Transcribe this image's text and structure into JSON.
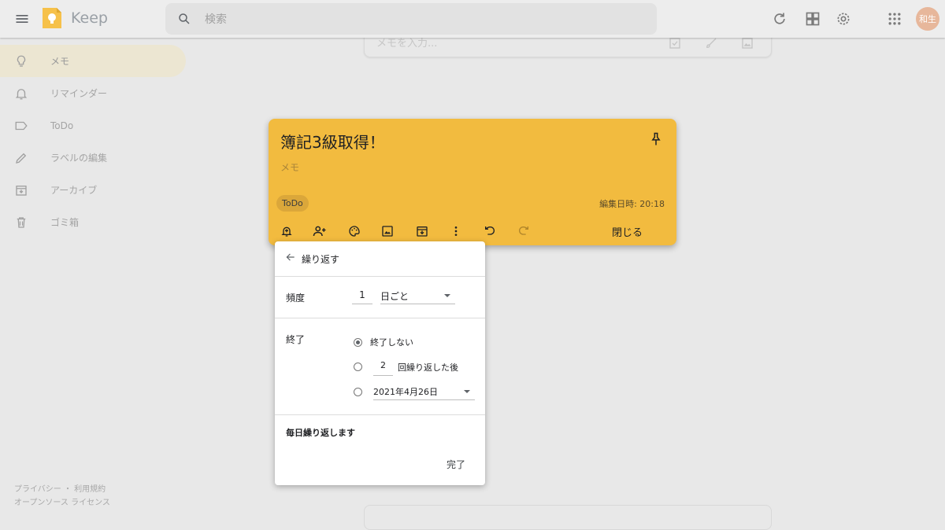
{
  "header": {
    "app_title": "Keep",
    "search_placeholder": "検索",
    "avatar_text": "和生"
  },
  "sidebar": {
    "items": [
      {
        "label": "メモ",
        "icon": "lightbulb-icon",
        "active": true
      },
      {
        "label": "リマインダー",
        "icon": "bell-icon"
      },
      {
        "label": "ToDo",
        "icon": "label-icon"
      },
      {
        "label": "ラベルの編集",
        "icon": "pencil-icon"
      },
      {
        "label": "アーカイブ",
        "icon": "archive-icon"
      },
      {
        "label": "ゴミ箱",
        "icon": "trash-icon"
      }
    ],
    "footer_line1": "プライバシー ・ 利用規約",
    "footer_line2": "オープンソース ライセンス"
  },
  "take_note": {
    "placeholder": "メモを入力..."
  },
  "note": {
    "title": "簿記3級取得！",
    "body": "メモ",
    "label": "ToDo",
    "edited": "編集日時: 20:18",
    "close_label": "閉じる",
    "color": "#f2bb3f"
  },
  "repeat_dialog": {
    "title": "繰り返す",
    "frequency_label": "頻度",
    "frequency_count": "1",
    "frequency_unit": "日ごと",
    "end_label": "終了",
    "option_never": "終了しない",
    "option_after_count": "2",
    "option_after_suffix": "回繰り返した後",
    "option_date": "2021年4月26日",
    "selected_option": "never",
    "summary": "毎日繰り返します",
    "done_label": "完了"
  }
}
